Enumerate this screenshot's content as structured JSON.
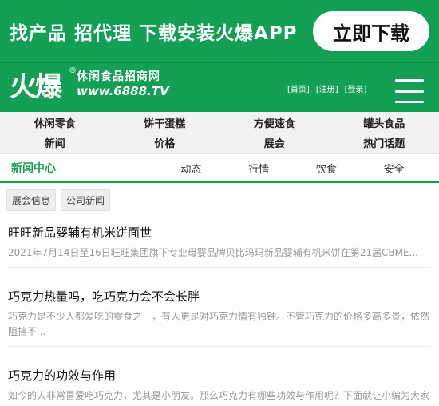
{
  "banner": {
    "promo_text": "找产品  招代理  下载安装火爆APP",
    "cta_label": "立即下载"
  },
  "header": {
    "logo_text": "火爆",
    "logo_reg": "®",
    "logo_subtitle": "休闲食品招商网",
    "logo_url": "www.6888.TV",
    "links": [
      "[首页]",
      "[注册]",
      "[登录]"
    ]
  },
  "category_nav": [
    {
      "top": "休闲零食",
      "bottom": "新闻"
    },
    {
      "top": "饼干蛋糕",
      "bottom": "价格"
    },
    {
      "top": "方便速食",
      "bottom": "展会"
    },
    {
      "top": "罐头食品",
      "bottom": "热门话题"
    }
  ],
  "tabs": {
    "active": "新闻中心",
    "items": [
      "动态",
      "行情",
      "饮食",
      "安全"
    ]
  },
  "chips": [
    "展会信息",
    "公司新闻"
  ],
  "articles": [
    {
      "title": "旺旺新品婴辅有机米饼面世",
      "summary": "2021年7月14日至16日旺旺集团旗下专业母婴品牌贝比玛玛新品婴辅有机米饼在第21届CBME..."
    },
    {
      "title": "巧克力热量吗，吃巧克力会不会长胖",
      "summary": "巧克力是不少人都爱吃的零食之一，有人更是对巧克力情有独钟。不管巧克力的价格多高多贵，依然阻挡不..."
    },
    {
      "title": "巧克力的功效与作用",
      "summary": "如今的人非常喜爱吃巧克力，尤其是小朋友。那么巧克力有哪些功效与作用呢？下面就让小编为大家介绍一..."
    }
  ],
  "colors": {
    "brand_green": "#13a054"
  }
}
